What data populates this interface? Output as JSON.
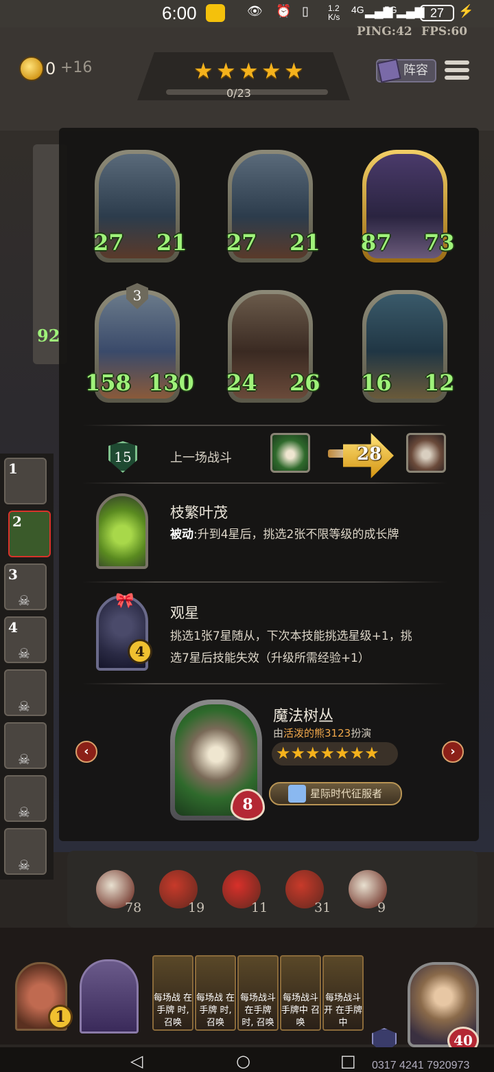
{
  "status_bar": {
    "time": "6:00",
    "net_speed": "1.2 K/s",
    "net_4g": "4G",
    "net_5g": "5G",
    "battery": "27",
    "ping": "PING:42",
    "fps": "FPS:60"
  },
  "top_hud": {
    "gold": "0",
    "gold_income": "+16",
    "tavern_stars": 5,
    "exp": "0/23",
    "lineup_label": "阵容"
  },
  "shop_cards": [
    {
      "attack": "27",
      "health": "21",
      "frame": "silver"
    },
    {
      "attack": "27",
      "health": "21",
      "frame": "silver"
    },
    {
      "attack": "87",
      "health": "73",
      "frame": "gold"
    },
    {
      "attack": "158",
      "health": "130",
      "frame": "silver",
      "level": "3"
    },
    {
      "attack": "24",
      "health": "26",
      "frame": "silver"
    },
    {
      "attack": "16",
      "health": "12",
      "frame": "silver"
    }
  ],
  "last_battle": {
    "shield_value": "15",
    "label": "上一场战斗",
    "damage": "28"
  },
  "skills": [
    {
      "name": "枝繁叶茂",
      "keyword": "被动",
      "desc": ":升到4星后，挑选2张不限等级的成长牌"
    },
    {
      "name": "观星",
      "level": "4",
      "desc_line1": "挑选1张7星随从，下次本技能挑选星级+1，挑",
      "desc_line2": "选7星后技能失效（升级所需经验+1）"
    }
  ],
  "hero": {
    "name": "魔法树丛",
    "sub_prefix": "由",
    "sub_player": "活泼的熊3123",
    "sub_suffix": "扮演",
    "stars": 7,
    "health": "8",
    "badge": "星际时代征服者"
  },
  "nav_arrows": {
    "left": "‹",
    "right": "›"
  },
  "items": [
    {
      "icon": "drum-icon",
      "count": "78"
    },
    {
      "icon": "firecracker-icon",
      "count": "19"
    },
    {
      "icon": "lantern-icon",
      "count": "11"
    },
    {
      "icon": "lucky-bag-icon",
      "count": "31"
    },
    {
      "icon": "clown-icon",
      "count": "9"
    }
  ],
  "hand_cards": [
    {
      "text": "每场战 在手牌 时, 召唤"
    },
    {
      "text": "每场战 在手牌 时, 召唤"
    },
    {
      "text": "每场战斗 在手牌 时, 召唤"
    },
    {
      "text": "每场战斗 手牌中 召唤"
    },
    {
      "text": "每场战斗开 在手牌中"
    }
  ],
  "left_bar": {
    "slots": [
      "1",
      "2",
      "3",
      "4",
      "",
      "",
      "",
      ""
    ]
  },
  "spell_level": "1",
  "player_health": "40",
  "uid": "0317 4241 7920973",
  "colors": {
    "gold_star": "#f5b21c",
    "stat_green": "#9ff27a",
    "accent_red": "#b42834",
    "panel_bg": "#141312"
  }
}
